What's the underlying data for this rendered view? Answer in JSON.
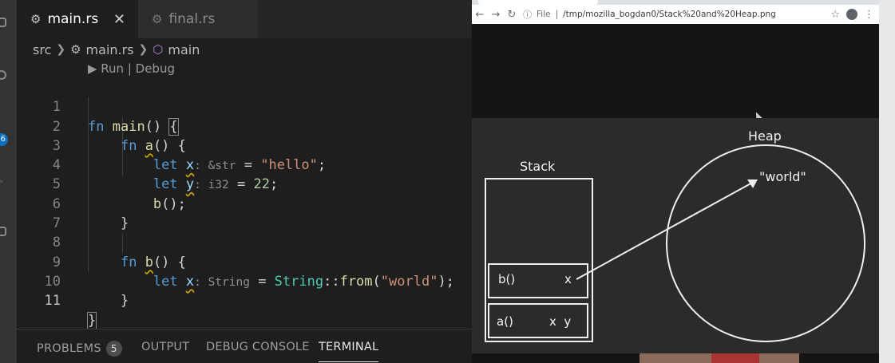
{
  "activity_bar": {
    "badge": "6"
  },
  "editor": {
    "tabs": [
      {
        "label": "main.rs",
        "active": true,
        "close": "✕"
      },
      {
        "label": "final.rs",
        "active": false
      }
    ],
    "breadcrumb": {
      "folder": "src",
      "file": "main.rs",
      "symbol": "main"
    },
    "codelens": "▶ Run | Debug",
    "line_numbers": [
      "1",
      "2",
      "3",
      "4",
      "5",
      "6",
      "7",
      "8",
      "9",
      "10",
      "11"
    ],
    "code": {
      "l1": {
        "kw": "fn",
        "name": "main",
        "rest": "() ",
        "brace": "{"
      },
      "l2": {
        "kw": "fn",
        "name": "a",
        "rest": "() {"
      },
      "l3": {
        "kw": "let",
        "var": "x",
        "hint": ": &str",
        "eq": " = ",
        "val": "\"hello\"",
        "end": ";"
      },
      "l4": {
        "kw": "let",
        "var": "y",
        "hint": ": i32",
        "eq": " = ",
        "val": "22",
        "end": ";"
      },
      "l5": {
        "name": "b",
        "rest": "();"
      },
      "l6": {
        "text": "}"
      },
      "l8": {
        "kw": "fn",
        "name": "b",
        "rest": "() {"
      },
      "l9": {
        "kw": "let",
        "var": "x",
        "hint": ": String",
        "eq": " = ",
        "type": "String",
        "sep": "::",
        "fn": "from",
        "open": "(",
        "val": "\"world\"",
        "close": ");"
      },
      "l10": {
        "text": "}"
      },
      "l11": {
        "text": "}"
      }
    }
  },
  "panel": {
    "tabs": [
      "PROBLEMS",
      "OUTPUT",
      "DEBUG CONSOLE",
      "TERMINAL"
    ],
    "problems_count": "5",
    "active_tab": "TERMINAL"
  },
  "browser": {
    "url_prefix": "File",
    "url": "/tmp/mozilla_bogdan0/Stack%20and%20Heap.png"
  },
  "slide": {
    "stack_title": "Stack",
    "heap_title": "Heap",
    "frames": [
      {
        "fn": "b()",
        "vars": "x"
      },
      {
        "fn": "a()",
        "vars": "x  y"
      }
    ],
    "heap_value": "\"world\""
  }
}
